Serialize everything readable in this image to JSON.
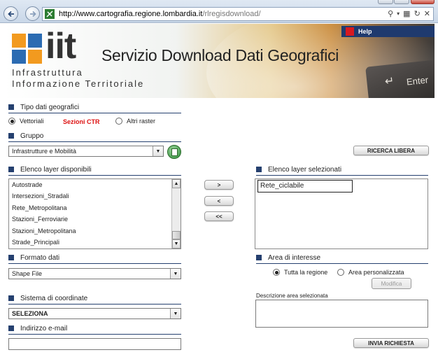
{
  "browser": {
    "url_domain": "http://www.cartografia.regione.lombardia.it",
    "url_path": "/rlregisdownload/"
  },
  "banner": {
    "logo_text": "iit",
    "logo_line1": "Infrastruttura",
    "logo_line2": "Informazione Territoriale",
    "title": "Servizio Download Dati Geografici",
    "help_label": "Help",
    "key_label": "Enter"
  },
  "tipo": {
    "header": "Tipo dati geografici",
    "option_vettoriali": "Vettoriali",
    "sezioni_ctr": "Sezioni CTR",
    "option_altri_raster": "Altri raster",
    "selected": "Vettoriali"
  },
  "gruppo": {
    "header": "Gruppo",
    "selected": "Infrastrutture e Mobilità"
  },
  "ricerca_libera_label": "RICERCA LIBERA",
  "layers_available": {
    "header": "Elenco layer disponibili",
    "items": [
      "Autostrade",
      "Intersezioni_Stradali",
      "Rete_Metropolitana",
      "Stazioni_Ferroviarie",
      "Stazioni_Metropolitana",
      "Strade_Principali"
    ]
  },
  "transfer_buttons": {
    "add": ">",
    "remove": "<",
    "remove_all": "<<"
  },
  "layers_selected": {
    "header": "Elenco layer selezionati",
    "items": [
      "Rete_ciclabile"
    ]
  },
  "formato": {
    "header": "Formato dati",
    "selected": "Shape File"
  },
  "area": {
    "header": "Area di interesse",
    "option_tutta": "Tutta la regione",
    "option_personalizzata": "Area personalizzata",
    "selected": "Tutta la regione",
    "modifica_label": "Modifica",
    "descrizione_label": "Descrizione area selezionata"
  },
  "coordinate": {
    "header": "Sistema di coordinate",
    "selected": "SELEZIONA"
  },
  "email": {
    "header": "Indirizzo e-mail",
    "value": ""
  },
  "invia_label": "INVIA RICHIESTA",
  "colors": {
    "section_accent": "#25406f",
    "sezioni_red": "#dd1111",
    "help_bar": "#1f3a6e"
  }
}
